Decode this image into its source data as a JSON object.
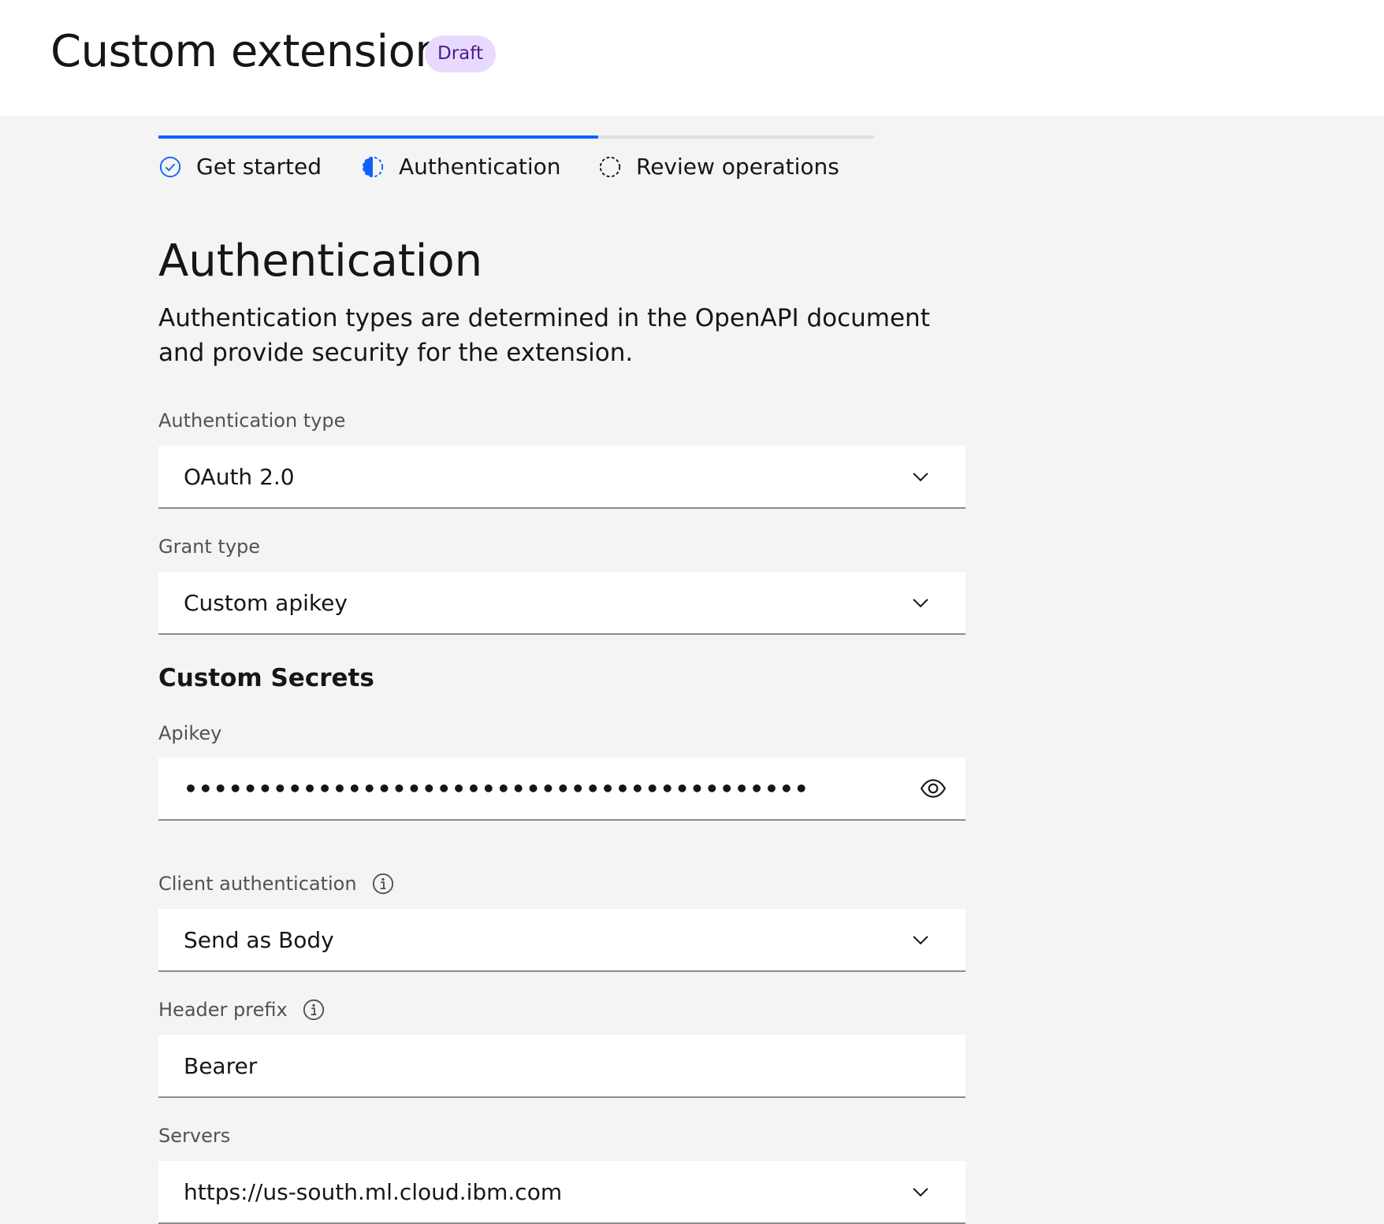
{
  "header": {
    "title": "Custom extension",
    "status_tag": "Draft"
  },
  "progress": {
    "steps": [
      {
        "label": "Get started",
        "state": "complete",
        "icon": "checkmark-circle-icon"
      },
      {
        "label": "Authentication",
        "state": "current",
        "icon": "half-circle-icon"
      },
      {
        "label": "Review operations",
        "state": "incomplete",
        "icon": "dashed-circle-icon"
      }
    ]
  },
  "section": {
    "title": "Authentication",
    "description": "Authentication types are determined in the OpenAPI document and provide security for the extension."
  },
  "fields": {
    "auth_type": {
      "label": "Authentication type",
      "value": "OAuth 2.0"
    },
    "grant_type": {
      "label": "Grant type",
      "value": "Custom apikey"
    },
    "custom_secrets_heading": "Custom Secrets",
    "apikey": {
      "label": "Apikey",
      "masked_value": "••••••••••••••••••••••••••••••••••••••••••"
    },
    "client_auth": {
      "label": "Client authentication",
      "value": "Send as Body"
    },
    "header_prefix": {
      "label": "Header prefix",
      "value": "Bearer"
    },
    "servers": {
      "label": "Servers",
      "value": "https://us-south.ml.cloud.ibm.com"
    }
  },
  "colors": {
    "accent": "#0f62fe",
    "draft_tag_bg": "#e8daff",
    "draft_tag_text": "#491d8b",
    "page_bg": "#f4f4f4"
  }
}
